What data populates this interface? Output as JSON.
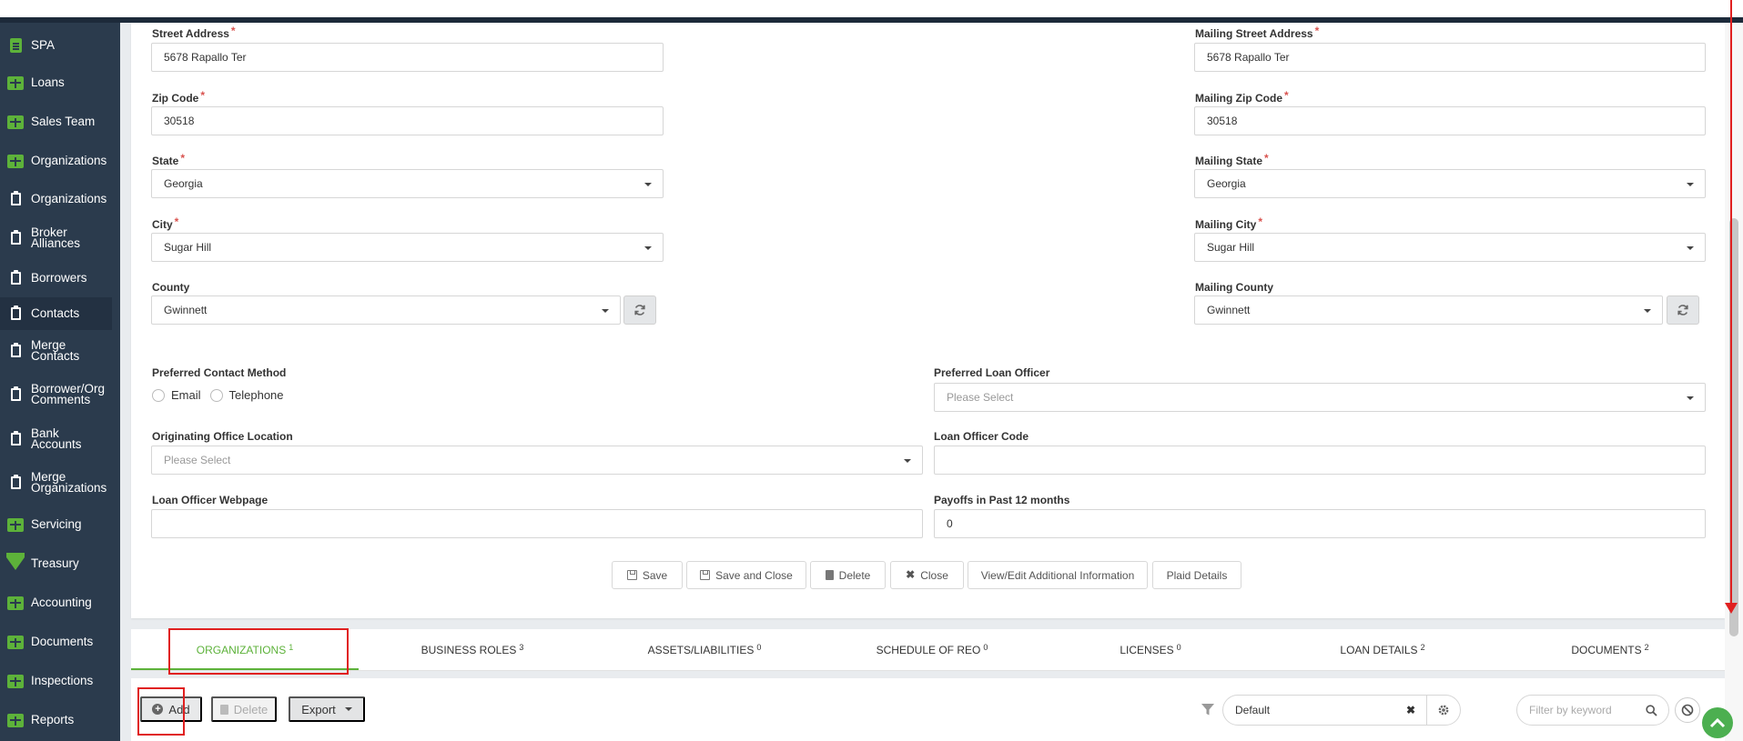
{
  "sidebar": {
    "items": [
      {
        "label": "SPA",
        "icon": "document-icon"
      },
      {
        "label": "Loans",
        "icon": "grid-icon"
      },
      {
        "label": "Sales Team",
        "icon": "grid-icon"
      },
      {
        "label": "Organizations",
        "icon": "grid-icon"
      },
      {
        "label": "Organizations",
        "icon": "clipboard-icon"
      },
      {
        "label": "Broker Alliances",
        "icon": "clipboard-icon"
      },
      {
        "label": "Borrowers",
        "icon": "clipboard-icon"
      },
      {
        "label": "Contacts",
        "icon": "clipboard-icon",
        "active": true
      },
      {
        "label": "Merge Contacts",
        "icon": "clipboard-icon"
      },
      {
        "label": "Borrower/Org Comments",
        "icon": "clipboard-icon"
      },
      {
        "label": "Bank Accounts",
        "icon": "clipboard-icon"
      },
      {
        "label": "Merge Organizations",
        "icon": "clipboard-icon"
      },
      {
        "label": "Servicing",
        "icon": "grid-icon"
      },
      {
        "label": "Treasury",
        "icon": "gem-icon"
      },
      {
        "label": "Accounting",
        "icon": "grid-icon"
      },
      {
        "label": "Documents",
        "icon": "grid-icon"
      },
      {
        "label": "Inspections",
        "icon": "grid-icon"
      },
      {
        "label": "Reports",
        "icon": "grid-icon"
      }
    ]
  },
  "form": {
    "street_address": {
      "label": "Street Address",
      "value": "5678 Rapallo Ter"
    },
    "zip_code": {
      "label": "Zip Code",
      "value": "30518"
    },
    "state": {
      "label": "State",
      "value": "Georgia"
    },
    "city": {
      "label": "City",
      "value": "Sugar Hill"
    },
    "county": {
      "label": "County",
      "value": "Gwinnett"
    },
    "mailing_street_address": {
      "label": "Mailing Street Address",
      "value": "5678 Rapallo Ter"
    },
    "mailing_zip_code": {
      "label": "Mailing Zip Code",
      "value": "30518"
    },
    "mailing_state": {
      "label": "Mailing State",
      "value": "Georgia"
    },
    "mailing_city": {
      "label": "Mailing City",
      "value": "Sugar Hill"
    },
    "mailing_county": {
      "label": "Mailing County",
      "value": "Gwinnett"
    },
    "preferred_contact_method": {
      "label": "Preferred Contact Method",
      "options": [
        "Email",
        "Telephone"
      ]
    },
    "preferred_loan_officer": {
      "label": "Preferred Loan Officer",
      "placeholder": "Please Select"
    },
    "originating_office_location": {
      "label": "Originating Office Location",
      "placeholder": "Please Select"
    },
    "loan_officer_code": {
      "label": "Loan Officer Code",
      "value": ""
    },
    "loan_officer_webpage": {
      "label": "Loan Officer Webpage",
      "value": ""
    },
    "payoffs_past_12": {
      "label": "Payoffs in Past 12 months",
      "value": "0"
    }
  },
  "actions": {
    "save": "Save",
    "save_close": "Save and Close",
    "delete": "Delete",
    "close": "Close",
    "view_edit": "View/Edit Additional Information",
    "plaid": "Plaid Details"
  },
  "tabs": [
    {
      "label": "ORGANIZATIONS",
      "count": "1",
      "active": true
    },
    {
      "label": "BUSINESS ROLES",
      "count": "3"
    },
    {
      "label": "ASSETS/LIABILITIES",
      "count": "0"
    },
    {
      "label": "SCHEDULE OF REO",
      "count": "0"
    },
    {
      "label": "LICENSES",
      "count": "0"
    },
    {
      "label": "LOAN DETAILS",
      "count": "2"
    },
    {
      "label": "DOCUMENTS",
      "count": "2"
    }
  ],
  "toolbar": {
    "add": "Add",
    "delete": "Delete",
    "export": "Export",
    "view_select": "Default",
    "filter_placeholder": "Filter by keyword"
  },
  "colors": {
    "accent_green": "#5db23a",
    "sidebar_bg": "#2b3b4d",
    "highlight_red": "#e02020"
  }
}
